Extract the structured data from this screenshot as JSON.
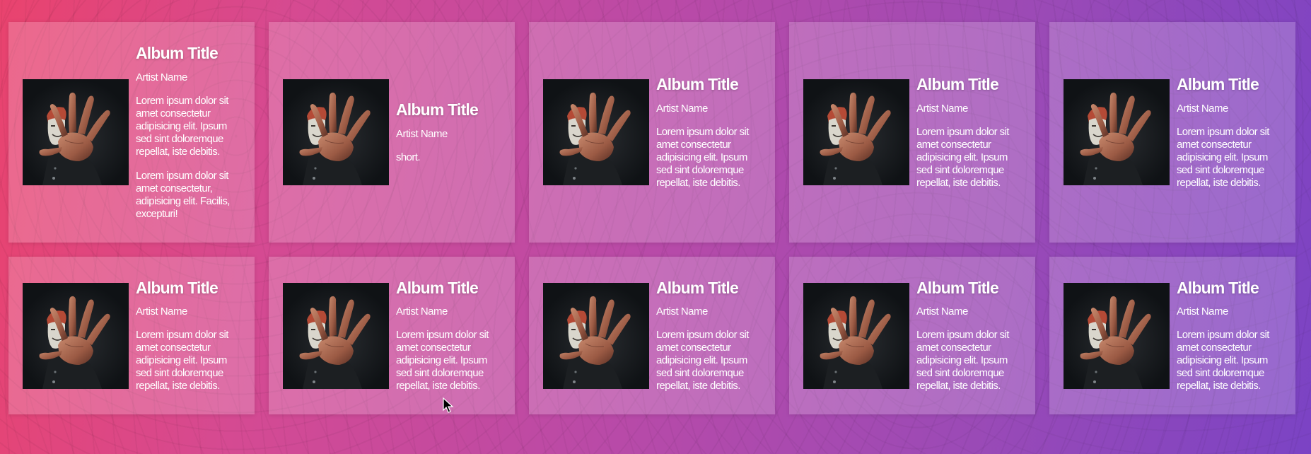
{
  "cards": [
    {
      "title": "Album Title",
      "artist": "Artist Name",
      "desc": [
        "Lorem ipsum dolor sit amet consectetur adipisicing elit. Ipsum sed sint doloremque repellat, iste debitis.",
        "Lorem ipsum dolor sit amet consectetur, adipisicing elit. Facilis, excepturi!"
      ]
    },
    {
      "title": "Album Title",
      "artist": "Artist Name",
      "desc": [
        "short."
      ]
    },
    {
      "title": "Album Title",
      "artist": "Artist Name",
      "desc": [
        "Lorem ipsum dolor sit amet consectetur adipisicing elit. Ipsum sed sint doloremque repellat, iste debitis."
      ]
    },
    {
      "title": "Album Title",
      "artist": "Artist Name",
      "desc": [
        "Lorem ipsum dolor sit amet consectetur adipisicing elit. Ipsum sed sint doloremque repellat, iste debitis."
      ]
    },
    {
      "title": "Album Title",
      "artist": "Artist Name",
      "desc": [
        "Lorem ipsum dolor sit amet consectetur adipisicing elit. Ipsum sed sint doloremque repellat, iste debitis."
      ]
    },
    {
      "title": "Album Title",
      "artist": "Artist Name",
      "desc": [
        "Lorem ipsum dolor sit amet consectetur adipisicing elit. Ipsum sed sint doloremque repellat, iste debitis."
      ]
    },
    {
      "title": "Album Title",
      "artist": "Artist Name",
      "desc": [
        "Lorem ipsum dolor sit amet consectetur adipisicing elit. Ipsum sed sint doloremque repellat, iste debitis."
      ]
    },
    {
      "title": "Album Title",
      "artist": "Artist Name",
      "desc": [
        "Lorem ipsum dolor sit amet consectetur adipisicing elit. Ipsum sed sint doloremque repellat, iste debitis."
      ]
    },
    {
      "title": "Album Title",
      "artist": "Artist Name",
      "desc": [
        "Lorem ipsum dolor sit amet consectetur adipisicing elit. Ipsum sed sint doloremque repellat, iste debitis."
      ]
    },
    {
      "title": "Album Title",
      "artist": "Artist Name",
      "desc": [
        "Lorem ipsum dolor sit amet consectetur adipisicing elit. Ipsum sed sint doloremque repellat, iste debitis."
      ]
    }
  ],
  "colors": {
    "gradient_start": "#e9436e",
    "gradient_end": "#7b43c4",
    "card_bg": "rgba(255,255,255,0.20)",
    "cover_bg": "#111418"
  },
  "icons": {
    "cover": "masked-hand-album-cover",
    "pointer": "mouse-pointer-icon"
  }
}
